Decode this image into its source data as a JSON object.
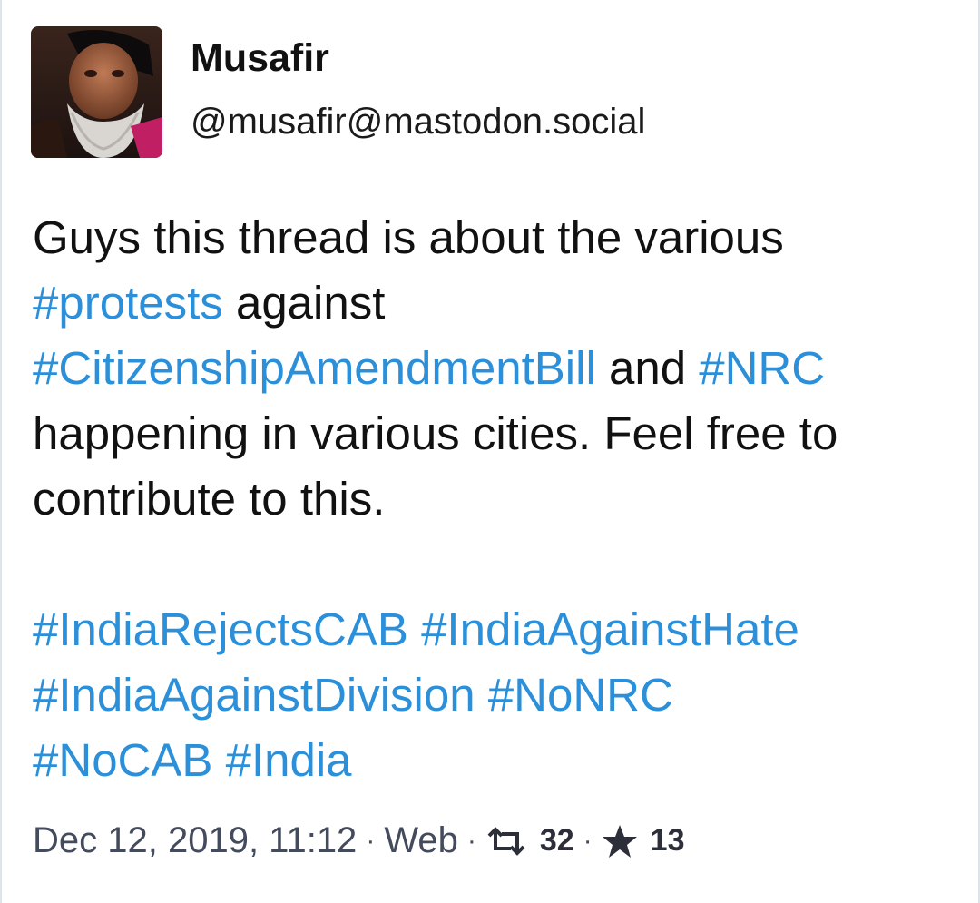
{
  "account": {
    "display_name": "Musafir",
    "handle": "@musafir@mastodon.social"
  },
  "status": {
    "para1": {
      "t1": "Guys this thread is about the various ",
      "tag1": "#protests",
      "t2": " against ",
      "tag2": "#CitizenshipAmendmentBill",
      "t3": " and ",
      "tag3": "#NRC",
      "t4": " happening in various cities. Feel free to contribute to this."
    },
    "tags": [
      "#IndiaRejectsCAB",
      "#IndiaAgainstHate",
      "#IndiaAgainstDivision",
      "#NoNRC",
      "#NoCAB",
      "#India"
    ]
  },
  "meta": {
    "timestamp": "Dec 12, 2019, 11:12",
    "separator": "·",
    "application": "Web",
    "boosts": "32",
    "favourites": "13"
  },
  "icons": {
    "boost": "retweet-icon",
    "favourite": "star-icon"
  },
  "colors": {
    "hashtag": "#2b90d9",
    "text": "#111111",
    "meta": "#444b5d"
  }
}
